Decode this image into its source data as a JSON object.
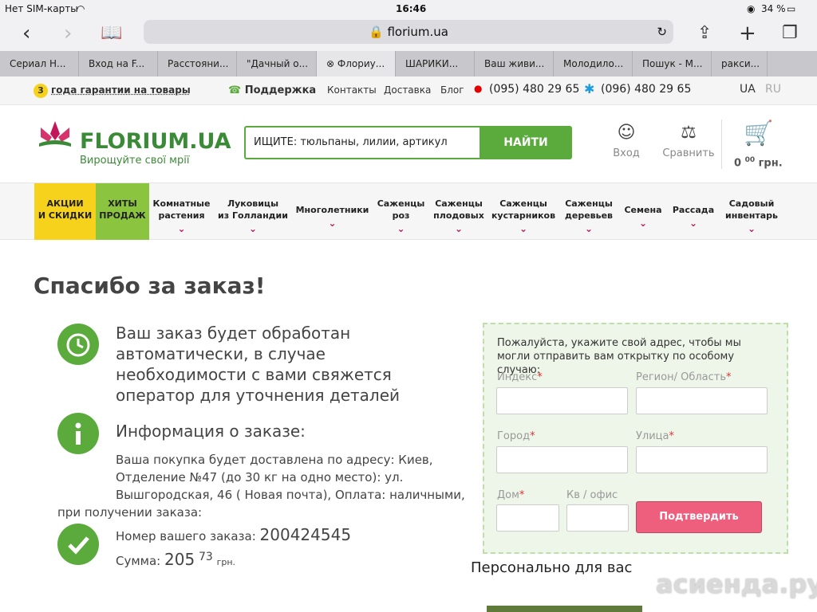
{
  "status_bar": {
    "carrier": "Нет SIM-карты",
    "time": "16:46",
    "battery": "34 %"
  },
  "safari": {
    "url": "florium.ua"
  },
  "tabs": [
    "Сериал Н...",
    "Вход на F...",
    "Расстояни...",
    "\"Дачный о...",
    "Флориу...",
    "ШАРИКИ...",
    "Ваш живи...",
    "Молодило...",
    "Пошук - М...",
    "ракси..."
  ],
  "topbar": {
    "guarantee_number": "3",
    "guarantee_text": "года гарантии на товары",
    "support": "Поддержка",
    "contacts": "Контакты",
    "delivery": "Доставка",
    "blog": "Блог",
    "phone1": "(095) 480 29 65",
    "phone2": "(096) 480 29 65",
    "lang_ua": "UA",
    "lang_ru": "RU"
  },
  "header": {
    "logo": "FLORIUM.UA",
    "slogan": "Вирощуйте свої мрії",
    "search_placeholder": "ИЩИТЕ: тюльпаны, лилии, артикул",
    "search_button": "НАЙТИ",
    "login": "Вход",
    "compare": "Сравнить",
    "cart_amount": "0",
    "cart_cents": "00",
    "cart_currency": "грн."
  },
  "menu": [
    {
      "line1": "АКЦИИ",
      "line2": "И СКИДКИ",
      "chevron": false
    },
    {
      "line1": "ХИТЫ",
      "line2": "ПРОДАЖ",
      "chevron": false
    },
    {
      "line1": "Комнатные",
      "line2": "растения",
      "chevron": true
    },
    {
      "line1": "Луковицы",
      "line2": "из Голландии",
      "chevron": true
    },
    {
      "line1": "Многолетники",
      "line2": "",
      "chevron": true
    },
    {
      "line1": "Саженцы",
      "line2": "роз",
      "chevron": true
    },
    {
      "line1": "Саженцы",
      "line2": "плодовых",
      "chevron": true
    },
    {
      "line1": "Саженцы",
      "line2": "кустарников",
      "chevron": true
    },
    {
      "line1": "Саженцы",
      "line2": "деревьев",
      "chevron": true
    },
    {
      "line1": "Семена",
      "line2": "",
      "chevron": true
    },
    {
      "line1": "Рассада",
      "line2": "",
      "chevron": true
    },
    {
      "line1": "Садовый",
      "line2": "инвентарь",
      "chevron": true
    }
  ],
  "main": {
    "title": "Спасибо за заказ!",
    "auto_line1": "Ваш заказ будет обработан",
    "auto_line2": "автоматически, в случае",
    "auto_line3": "необходимости с вами свяжется",
    "auto_line4": "оператор для уточнения деталей",
    "info_title": "Информация о заказе:",
    "addr_line1": "Ваша покупка будет доставлена по адресу: Киев,",
    "addr_line2": "Отделение №47 (до 30 кг на одно место): ул.",
    "addr_line3": "Вышгородская, 46 ( Новая почта), Оплата: наличными,",
    "addr_line4": "при получении заказа:",
    "order_label": "Номер вашего заказа:",
    "order_number": "200424545",
    "sum_label": "Сумма:",
    "sum_main": "205",
    "sum_cents": "73",
    "sum_currency": "грн."
  },
  "form": {
    "intro": "Пожалуйста, укажите свой адрес, чтобы мы могли отправить вам открытку по особому случаю:",
    "index": "Индекс",
    "region": "Регион/ Область",
    "city": "Город",
    "street": "Улица",
    "house": "Дом",
    "apt": "Кв / офис",
    "required_mark": "*",
    "confirm": "Подтвердить"
  },
  "personal_title": "Персонально для вас",
  "watermark": "асиенда.ру",
  "colors": {
    "green": "#5aaa3c",
    "pink": "#c2185b",
    "yellow": "#f7d21c",
    "confirm": "#ee5f7e"
  }
}
